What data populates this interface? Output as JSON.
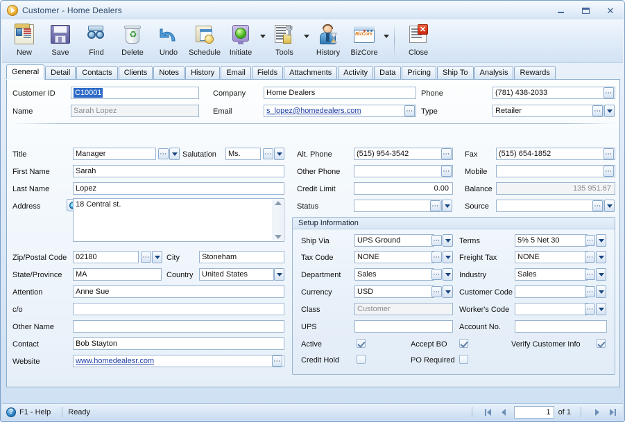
{
  "window": {
    "title": "Customer - Home Dealers",
    "app_icon": "media-play-circle-icon",
    "minimize": "minimize-icon",
    "maximize": "maximize-icon",
    "close": "close-icon"
  },
  "toolbar": {
    "buttons": [
      {
        "label": "New",
        "icon": "new-record-icon",
        "dropdown": false
      },
      {
        "label": "Save",
        "icon": "floppy-disk-save-icon",
        "dropdown": false
      },
      {
        "label": "Find",
        "icon": "binoculars-find-icon",
        "dropdown": false
      },
      {
        "label": "Delete",
        "icon": "recycle-bin-delete-icon",
        "dropdown": false
      },
      {
        "label": "Undo",
        "icon": "undo-arrow-icon",
        "dropdown": false
      },
      {
        "label": "Schedule",
        "icon": "calendar-schedule-icon",
        "dropdown": false
      },
      {
        "label": "Initiate",
        "icon": "green-light-initiate-icon",
        "dropdown": true
      },
      {
        "label": "Tools",
        "icon": "wrench-tools-icon",
        "dropdown": true
      },
      {
        "label": "History",
        "icon": "person-hourglass-history-icon",
        "dropdown": false
      },
      {
        "label": "BizCore",
        "icon": "bizcore-window-icon",
        "dropdown": true
      },
      {
        "label": "Close",
        "icon": "document-close-icon",
        "dropdown": false
      }
    ]
  },
  "tabs": {
    "active": "General",
    "items": [
      "General",
      "Detail",
      "Contacts",
      "Clients",
      "Notes",
      "History",
      "Email",
      "Fields",
      "Attachments",
      "Activity",
      "Data",
      "Pricing",
      "Ship To",
      "Analysis",
      "Rewards"
    ]
  },
  "header_section": {
    "customer_id": {
      "label": "Customer ID",
      "value": "C10001",
      "selected": true
    },
    "name": {
      "label": "Name",
      "value": "Sarah Lopez",
      "readonly": true
    },
    "company": {
      "label": "Company",
      "value": "Home Dealers"
    },
    "email": {
      "label": "Email",
      "value": "s_lopez@homedealers.com",
      "link": true,
      "has_dots": true
    },
    "phone": {
      "label": "Phone",
      "value": "(781) 438-2033",
      "has_dots": true
    },
    "type": {
      "label": "Type",
      "value": "Retailer",
      "has_dots": true,
      "has_caret": true
    }
  },
  "left_column": {
    "title": {
      "label": "Title",
      "value": "Manager",
      "has_dots": true,
      "has_caret": true
    },
    "salutation": {
      "label": "Salutation",
      "value": "Ms.",
      "has_dots": true,
      "has_caret": true
    },
    "first_name": {
      "label": "First Name",
      "value": "Sarah"
    },
    "last_name": {
      "label": "Last Name",
      "value": "Lopez"
    },
    "address": {
      "label": "Address",
      "value": "18 Central st.",
      "globe_icon": "globe-map-icon"
    },
    "zip": {
      "label": "Zip/Postal Code",
      "value": "02180",
      "has_dots": true,
      "has_caret": true
    },
    "city": {
      "label": "City",
      "value": "Stoneham"
    },
    "state": {
      "label": "State/Province",
      "value": "MA"
    },
    "country": {
      "label": "Country",
      "value": "United States",
      "has_caret": true
    },
    "attention": {
      "label": "Attention",
      "value": "Anne Sue"
    },
    "co": {
      "label": "c/o",
      "value": ""
    },
    "other_name": {
      "label": "Other Name",
      "value": ""
    },
    "contact": {
      "label": "Contact",
      "value": "Bob Stayton"
    },
    "website": {
      "label": "Website",
      "value": "www.homedealesr.com",
      "link": true,
      "has_dots": true
    }
  },
  "right_column": {
    "alt_phone": {
      "label": "Alt. Phone",
      "value": "(515) 954-3542",
      "has_dots": true
    },
    "fax": {
      "label": "Fax",
      "value": "(515) 654-1852",
      "has_dots": true
    },
    "other_phone": {
      "label": "Other Phone",
      "value": "",
      "has_dots": true
    },
    "mobile": {
      "label": "Mobile",
      "value": "",
      "has_dots": true
    },
    "credit_limit": {
      "label": "Credit Limit",
      "value": "0.00"
    },
    "balance": {
      "label": "Balance",
      "value": "135 951.67",
      "readonly": true
    },
    "status": {
      "label": "Status",
      "value": "",
      "has_dots": true,
      "has_caret": true
    },
    "source": {
      "label": "Source",
      "value": "",
      "has_dots": true,
      "has_caret": true
    }
  },
  "setup_information": {
    "title": "Setup Information",
    "fields": {
      "ship_via": {
        "label": "Ship Via",
        "value": "UPS Ground",
        "has_dots": true,
        "has_caret": true
      },
      "terms": {
        "label": "Terms",
        "value": "5% 5 Net 30",
        "has_dots": true,
        "has_caret": true
      },
      "tax_code": {
        "label": "Tax Code",
        "value": "NONE",
        "has_dots": true,
        "has_caret": true
      },
      "freight_tax": {
        "label": "Freight Tax",
        "value": "NONE",
        "has_dots": true,
        "has_caret": true
      },
      "department": {
        "label": "Department",
        "value": "Sales",
        "has_dots": true,
        "has_caret": true
      },
      "industry": {
        "label": "Industry",
        "value": "Sales",
        "has_dots": true,
        "has_caret": true
      },
      "currency": {
        "label": "Currency",
        "value": "USD",
        "has_dots": true,
        "has_caret": true
      },
      "customer_code": {
        "label": "Customer Code",
        "value": "",
        "has_dots": true,
        "has_caret": true
      },
      "class": {
        "label": "Class",
        "value": "Customer",
        "readonly": true
      },
      "workers_code": {
        "label": "Worker's Code",
        "value": "",
        "has_dots": true,
        "has_caret": true
      },
      "ups": {
        "label": "UPS",
        "value": ""
      },
      "account_no": {
        "label": "Account No.",
        "value": ""
      }
    },
    "checkboxes": [
      {
        "label": "Active",
        "checked": true
      },
      {
        "label": "Accept BO",
        "checked": true
      },
      {
        "label": "Verify Customer Info",
        "checked": true
      },
      {
        "label": "Credit Hold",
        "checked": false
      },
      {
        "label": "PO Required",
        "checked": false
      }
    ]
  },
  "statusbar": {
    "help_icon": "help-question-icon",
    "help_label": "F1 - Help",
    "status_text": "Ready",
    "nav": {
      "first_icon": "nav-first-icon",
      "prev_icon": "nav-prev-icon",
      "page_value": "1",
      "of_label": "of 1",
      "next_icon": "nav-next-icon",
      "last_icon": "nav-last-icon"
    }
  },
  "colors": {
    "window_border": "#7ba0c8",
    "title_text": "#2c4a6b",
    "field_border": "#9bb4d0",
    "link": "#1f3fa8",
    "selection": "#2d6ac7",
    "readonly_bg": "#f2f4f6",
    "group_border": "#9bb7d4"
  }
}
